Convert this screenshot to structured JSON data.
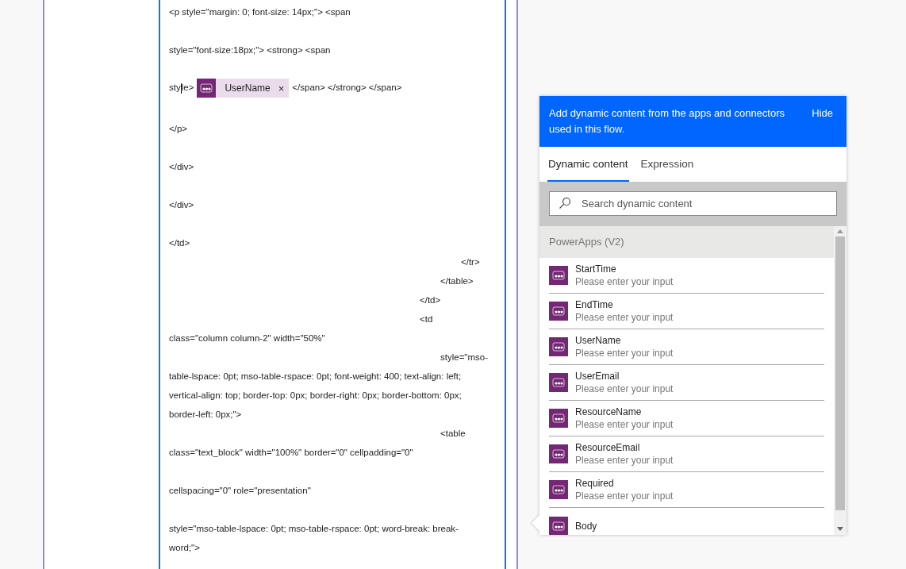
{
  "editor": {
    "lines": [
      {
        "kind": "para",
        "text": "<p style=\"margin: 0; font-size: 14px;\"> <span"
      },
      {
        "kind": "para",
        "text": "style=\"font-size:18px;\"> <strong> <span"
      },
      {
        "kind": "token-line",
        "before_cursor": "sty",
        "after_cursor": "le>",
        "token": {
          "label": "UserName",
          "remove": "×"
        },
        "after": "</span> </strong> </span>"
      },
      {
        "kind": "para",
        "text": "</p>"
      },
      {
        "kind": "para",
        "text": "</div>"
      },
      {
        "kind": "para",
        "text": "</div>"
      },
      {
        "kind": "para",
        "text": "</td>"
      },
      {
        "kind": "wrap-widest",
        "text": "</tr>"
      },
      {
        "kind": "wrap-wider",
        "text": "</table>"
      },
      {
        "kind": "wrap-wide",
        "text": "</td>"
      },
      {
        "kind": "wrap-wide",
        "text": "<td"
      },
      {
        "kind": "wrap",
        "text": "class=\"column column-2\" width=\"50%\""
      },
      {
        "kind": "wrap-wider",
        "text": "style=\"mso-"
      },
      {
        "kind": "wrap",
        "text": "table-lspace: 0pt; mso-table-rspace: 0pt; font-weight: 400; text-align: left;"
      },
      {
        "kind": "wrap",
        "text": "vertical-align: top; border-top: 0px; border-right: 0px; border-bottom: 0px;"
      },
      {
        "kind": "wrap",
        "text": "border-left: 0px;\">"
      },
      {
        "kind": "wrap-wider",
        "text": "<table"
      },
      {
        "kind": "wrap",
        "text": "class=\"text_block\" width=\"100%\" border=\"0\" cellpadding=\"0\""
      },
      {
        "kind": "para",
        "text": "cellspacing=\"0\" role=\"presentation\""
      },
      {
        "kind": "para",
        "text": "style=\"mso-table-lspace: 0pt; mso-table-rspace: 0pt; word-break: break-"
      },
      {
        "kind": "wrap",
        "text": "word;\">"
      }
    ]
  },
  "dynamic_panel": {
    "message": "Add dynamic content from the apps and connectors used in this flow.",
    "hide": "Hide",
    "tabs": [
      {
        "label": "Dynamic content",
        "selected": true
      },
      {
        "label": "Expression",
        "selected": false
      }
    ],
    "search": {
      "placeholder": "Search dynamic content"
    },
    "group": "PowerApps (V2)",
    "items": [
      {
        "name": "StartTime",
        "description": "Please enter your input"
      },
      {
        "name": "EndTime",
        "description": "Please enter your input"
      },
      {
        "name": "UserName",
        "description": "Please enter your input"
      },
      {
        "name": "UserEmail",
        "description": "Please enter your input"
      },
      {
        "name": "ResourceName",
        "description": "Please enter your input"
      },
      {
        "name": "ResourceEmail",
        "description": "Please enter your input"
      },
      {
        "name": "Required",
        "description": "Please enter your input"
      },
      {
        "name": "Body"
      }
    ]
  }
}
